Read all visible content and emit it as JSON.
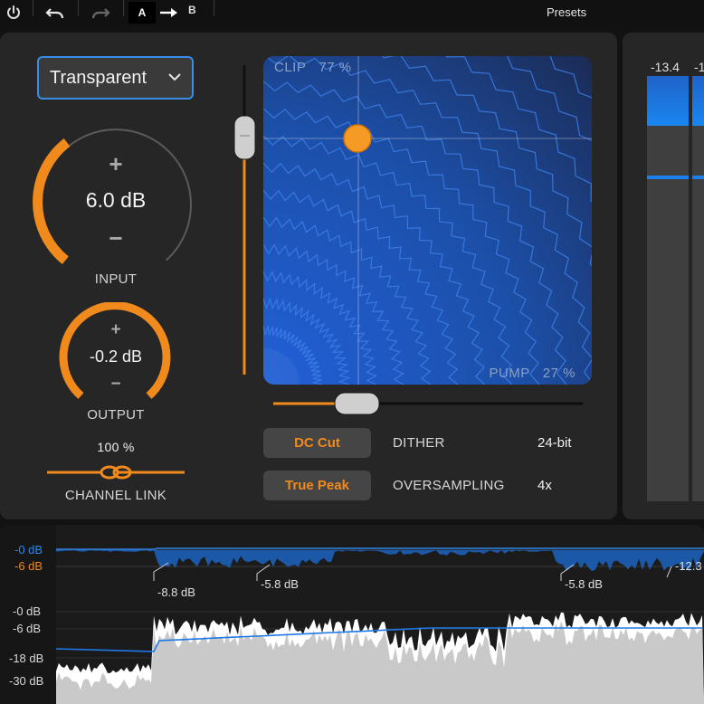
{
  "toolbar": {
    "power_icon": "power-icon",
    "undo_icon": "undo-icon",
    "redo_icon": "redo-icon",
    "ab_a": "A",
    "ab_b": "B",
    "presets_label": "Presets"
  },
  "mode": {
    "selected": "Transparent"
  },
  "input": {
    "plus": "+",
    "value": "6.0 dB",
    "minus": "−",
    "label": "INPUT"
  },
  "output": {
    "plus": "+",
    "value": "-0.2 dB",
    "minus": "−",
    "label": "OUTPUT"
  },
  "channel_link": {
    "value": "100 %",
    "label": "CHANNEL LINK"
  },
  "xy_pad": {
    "clip_label": "CLIP",
    "clip_value": "77 %",
    "pump_label": "PUMP",
    "pump_value": "27 %"
  },
  "buttons": {
    "dc_cut": "DC Cut",
    "true_peak": "True Peak"
  },
  "options": {
    "dither_label": "DITHER",
    "dither_value": "24-bit",
    "oversampling_label": "OVERSAMPLING",
    "oversampling_value": "4x"
  },
  "meters": {
    "left_value": "-13.4",
    "right_value": "-1"
  },
  "history": {
    "gr_scale": [
      "-0 dB",
      "-6 dB"
    ],
    "level_scale": [
      "-0 dB",
      "-6 dB",
      "-18 dB",
      "-30 dB"
    ],
    "markers": [
      "-8.8 dB",
      "-5.8 dB",
      "-5.8 dB",
      "-12.3"
    ]
  },
  "colors": {
    "accent": "#f08a1c",
    "blue": "#2a6fe0",
    "panel": "#262626"
  }
}
